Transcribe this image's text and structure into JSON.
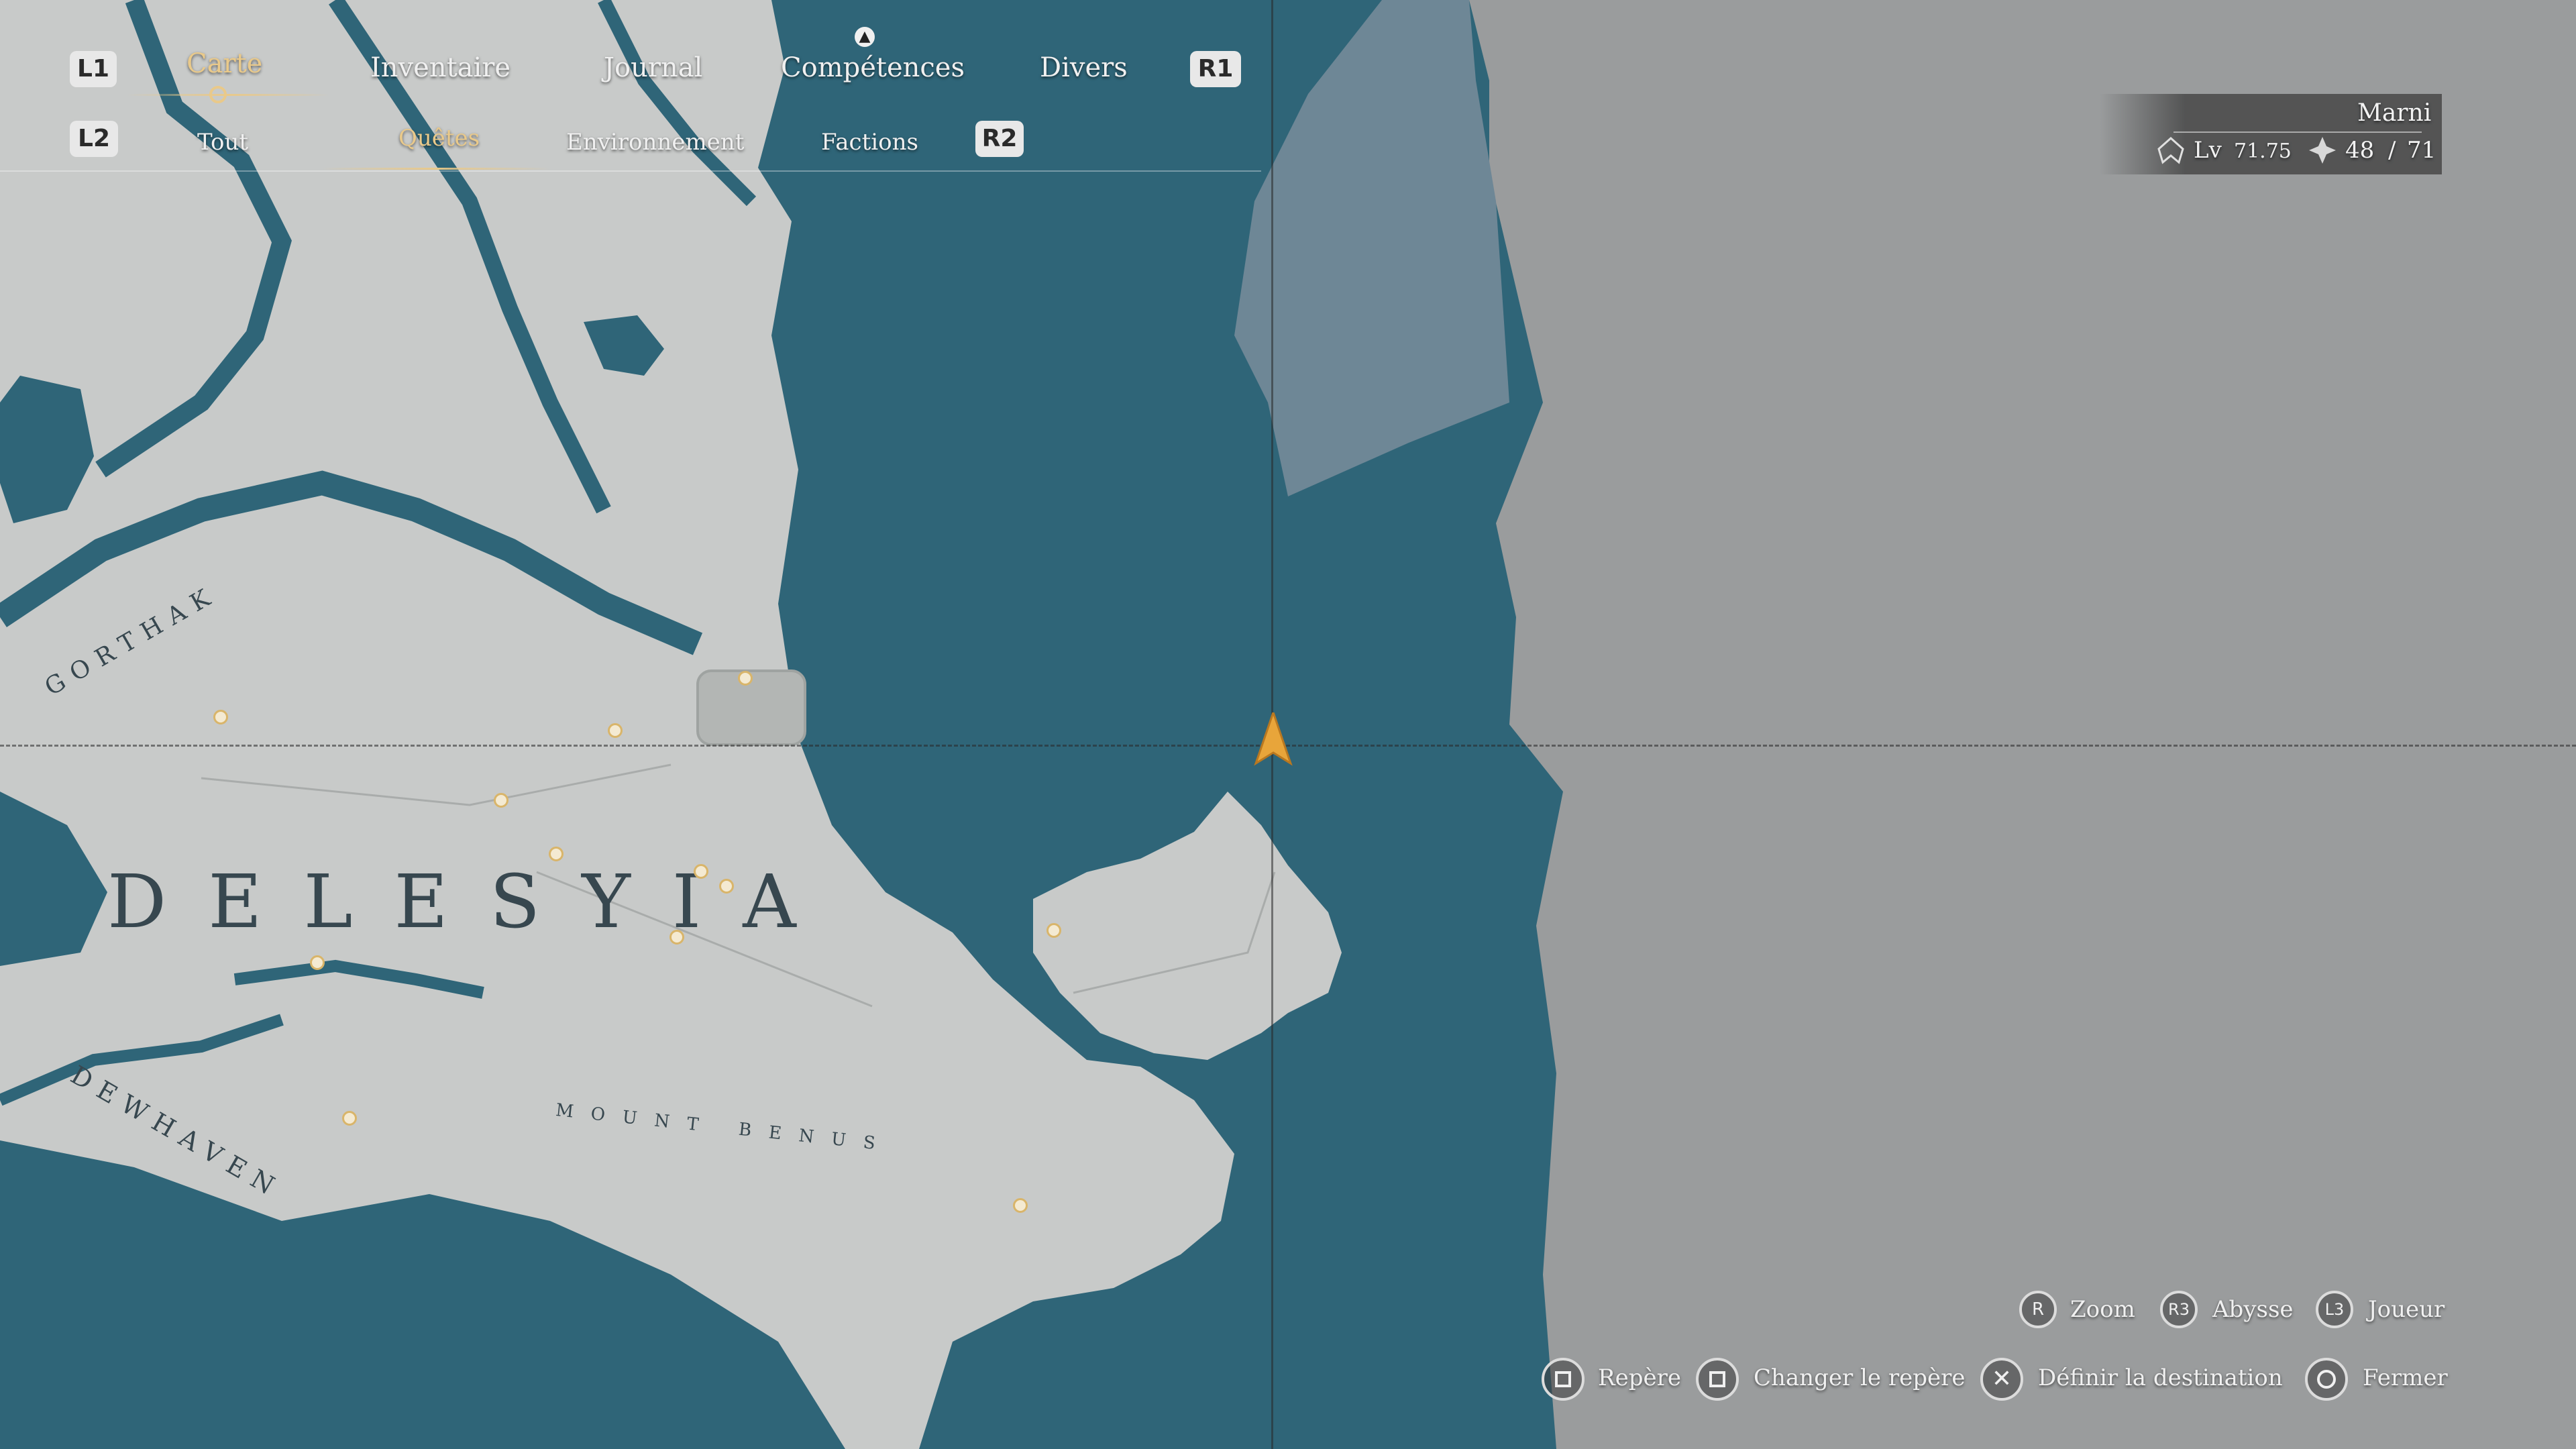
{
  "menu": {
    "tabs": [
      {
        "label": "Carte",
        "active": true
      },
      {
        "label": "Inventaire",
        "active": false
      },
      {
        "label": "Journal",
        "active": false
      },
      {
        "label": "Compétences",
        "active": false
      },
      {
        "label": "Divers",
        "active": false
      }
    ],
    "left_bumper": "L1",
    "right_bumper": "R1",
    "left_trigger": "L2",
    "right_trigger": "R2",
    "subtabs": [
      {
        "label": "Tout",
        "active": false
      },
      {
        "label": "Quêtes",
        "active": true
      },
      {
        "label": "Environnement",
        "active": false
      },
      {
        "label": "Factions",
        "active": false
      }
    ]
  },
  "player": {
    "name": "Marni",
    "level_prefix": "Lv",
    "level": "71.75",
    "points": "48",
    "points_sep": "/",
    "points_max": "71"
  },
  "map": {
    "regions": [
      "GORTHAK",
      "DELESYIA",
      "DEWHAVEN",
      "MOUNT BENUS"
    ],
    "colors": {
      "land": "#c8cac9",
      "water": "#2f6578",
      "fog": "#9b9d9e",
      "marker": "#e8a53a"
    }
  },
  "hints_top": [
    {
      "button": "R",
      "label": "Zoom"
    },
    {
      "button": "R3",
      "label": "Abysse"
    },
    {
      "button": "L3",
      "label": "Joueur"
    }
  ],
  "hints_bottom": [
    {
      "button": "square",
      "label": "Repère"
    },
    {
      "button": "square",
      "label": "Changer le repère"
    },
    {
      "button": "cross",
      "label": "Définir la destination"
    },
    {
      "button": "circle",
      "label": "Fermer"
    }
  ]
}
